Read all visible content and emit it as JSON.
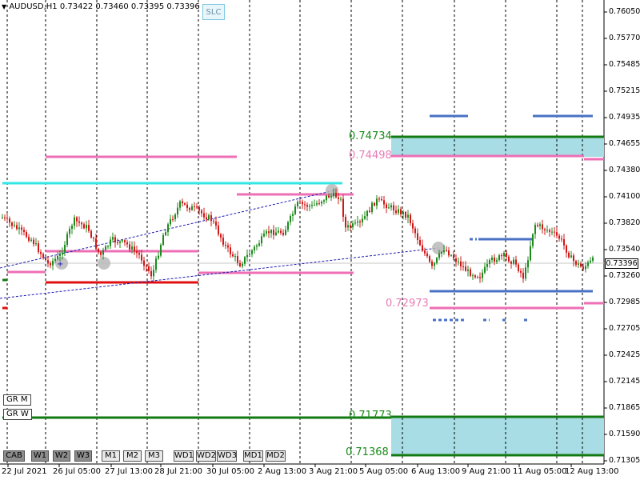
{
  "window": {
    "header_arrow_icon": "triangle-down-icon",
    "symbol": "AUDUSD,H1",
    "ohlc": "0.73422 0.73460 0.73395 0.73396"
  },
  "slc_button": "SLC",
  "timeframe_buttons": [
    {
      "label": "CAB",
      "style": "dark"
    },
    {
      "label": "W1",
      "style": "dark"
    },
    {
      "label": "W2",
      "style": "dark"
    },
    {
      "label": "W3",
      "style": "dark"
    },
    {
      "label": "M1",
      "style": "light"
    },
    {
      "label": "M2",
      "style": "light"
    },
    {
      "label": "M3",
      "style": "light"
    },
    {
      "label": "WD1",
      "style": "light"
    },
    {
      "label": "WD2",
      "style": "light"
    },
    {
      "label": "WD3",
      "style": "light"
    },
    {
      "label": "MD1",
      "style": "light"
    },
    {
      "label": "MD2",
      "style": "light"
    }
  ],
  "gr_buttons": [
    "GR M",
    "GR W"
  ],
  "price_axis": [
    "0.76050",
    "0.75770",
    "0.75485",
    "0.75215",
    "0.74935",
    "0.74655",
    "0.74380",
    "0.74100",
    "0.73820",
    "0.73540",
    "0.73260",
    "0.72985",
    "0.72705",
    "0.72425",
    "0.72145",
    "0.71865",
    "0.71590",
    "0.71305"
  ],
  "time_axis": [
    "22 Jul 2021",
    "26 Jul 05:00",
    "27 Jul 13:00",
    "28 Jul 21:00",
    "30 Jul 05:00",
    "2 Aug 13:00",
    "3 Aug 21:00",
    "5 Aug 05:00",
    "6 Aug 13:00",
    "9 Aug 21:00",
    "11 Aug 05:00",
    "12 Aug 13:00"
  ],
  "current_price": "0.73396",
  "level_labels": [
    {
      "text": "0.74734",
      "color": "#1a8a1a"
    },
    {
      "text": "0.74498",
      "color": "#e87cb5"
    },
    {
      "text": "0.72973",
      "color": "#e87cb5"
    },
    {
      "text": "0.71773",
      "color": "#1a8a1a"
    },
    {
      "text": "0.71368",
      "color": "#1a8a1a"
    }
  ],
  "colors": {
    "up_candle": "#1e8a1e",
    "down_candle": "#d01818",
    "pink": "#ee6fb5",
    "green": "#137a13",
    "cyan": "#33e6e6",
    "red": "#e01010",
    "blue": "#4a72c4",
    "zone": "#a8dde6",
    "grid": "#000000"
  }
}
